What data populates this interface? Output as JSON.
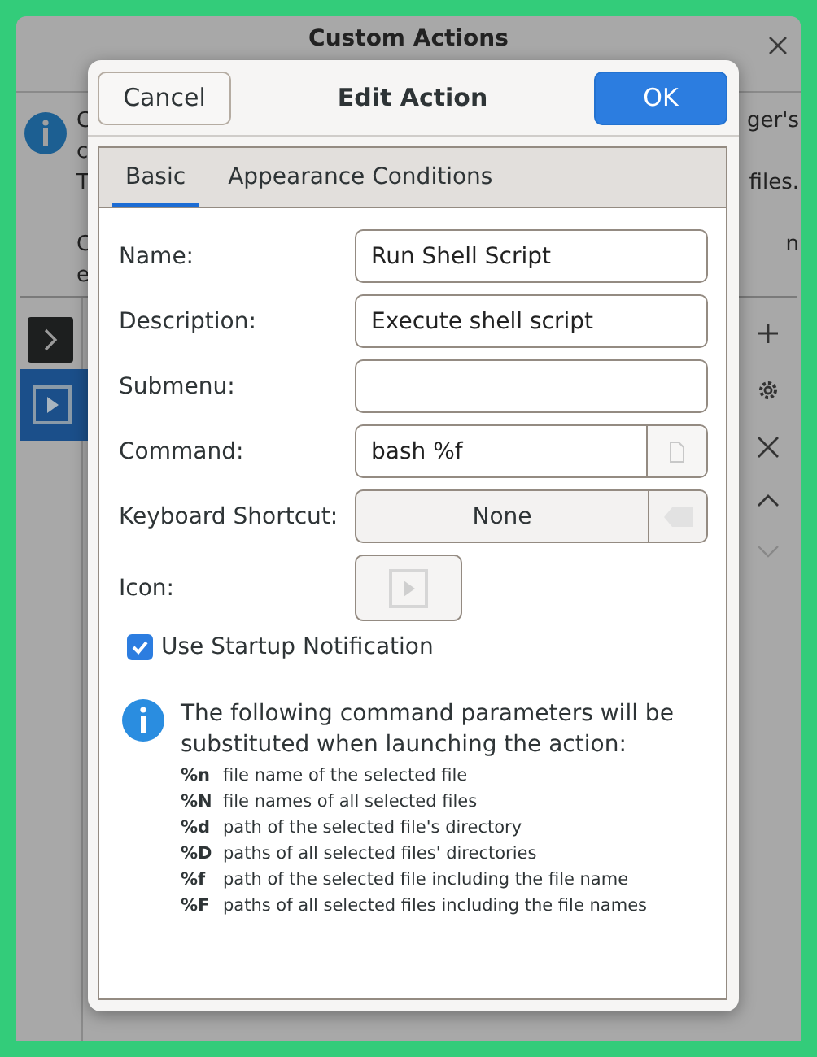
{
  "background_window": {
    "title": "Custom Actions",
    "info_lines": [
      {
        "start": "C",
        "end": "ger's"
      },
      {
        "start": "c"
      },
      {
        "start": "T",
        "end": "files."
      },
      {
        "start": "C",
        "end": "n"
      },
      {
        "start": "e"
      }
    ],
    "actions": [
      {
        "kind": "terminal",
        "selected": false
      },
      {
        "kind": "play",
        "selected": true
      }
    ]
  },
  "dialog": {
    "title": "Edit Action",
    "cancel": "Cancel",
    "ok": "OK",
    "tabs": [
      {
        "label": "Basic",
        "selected": true
      },
      {
        "label": "Appearance Conditions",
        "selected": false
      }
    ],
    "fields": [
      {
        "kind": "text",
        "label": "Name:",
        "value": "Run Shell Script"
      },
      {
        "kind": "text",
        "label": "Description:",
        "value": "Execute shell script"
      },
      {
        "kind": "text",
        "label": "Submenu:"
      },
      {
        "kind": "file",
        "label": "Command:",
        "value": "bash %f"
      },
      {
        "kind": "shortcut",
        "label": "Keyboard Shortcut:",
        "value": "None"
      },
      {
        "kind": "icon",
        "label": "Icon:"
      }
    ],
    "startup_notification": {
      "label": "Use Startup Notification",
      "checked": true
    },
    "info": "The following command parameters will be substituted when launching the action:",
    "parameters": [
      {
        "code": "%n",
        "text": "file name of the selected file"
      },
      {
        "code": "%N",
        "text": "file names of all selected files"
      },
      {
        "code": "%d",
        "text": "path of the selected file's directory"
      },
      {
        "code": "%D",
        "text": "paths of all selected files' directories"
      },
      {
        "code": "%f",
        "text": "path of the selected file including the file name"
      },
      {
        "code": "%F",
        "text": "paths of all selected files including the file names"
      }
    ]
  }
}
